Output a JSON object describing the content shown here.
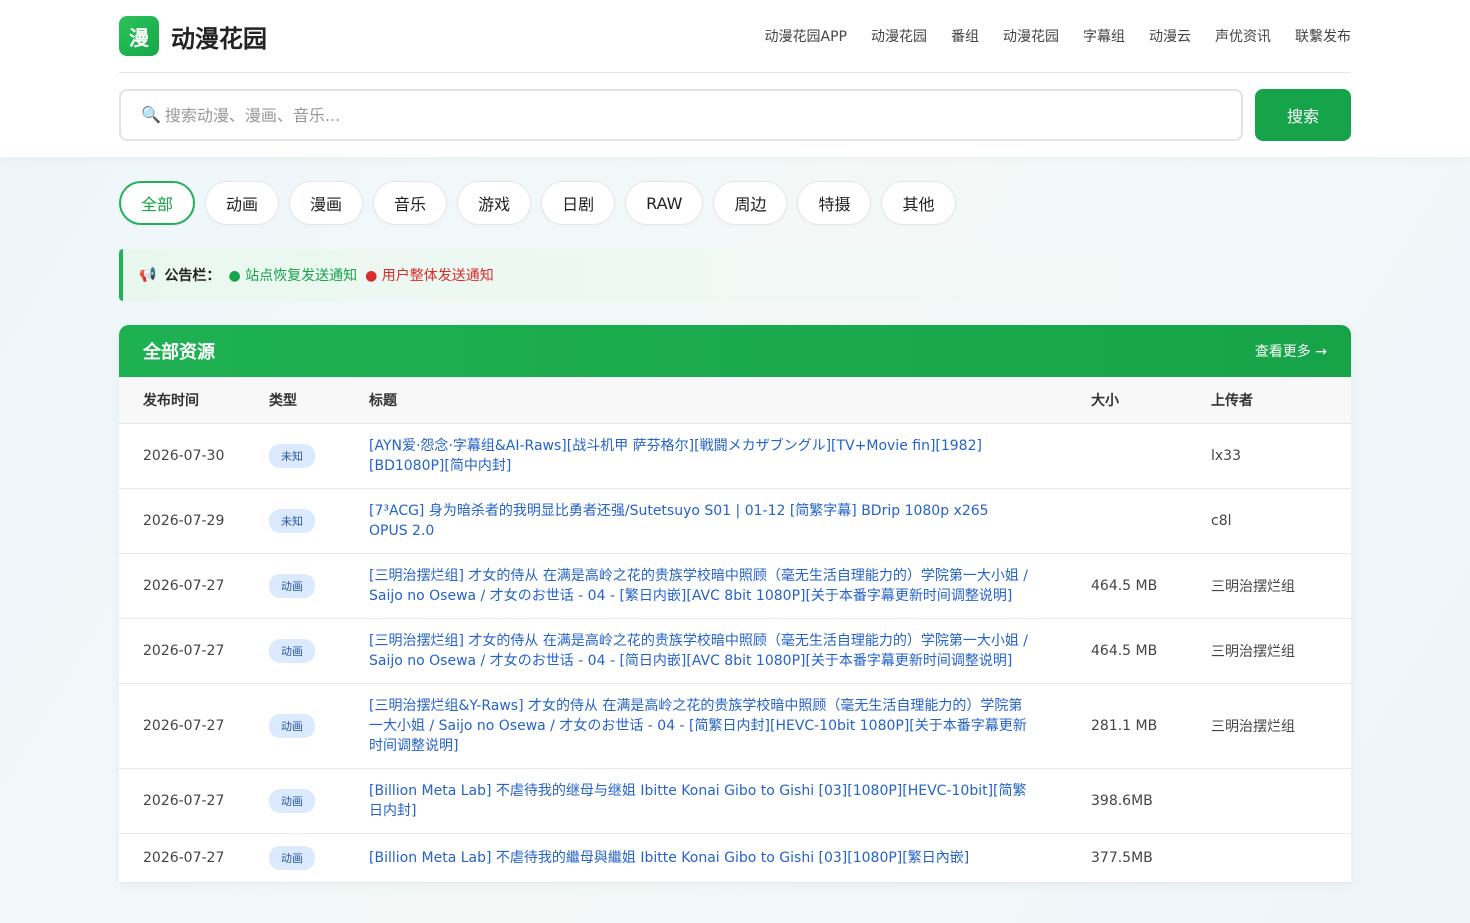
{
  "brand": {
    "logo_char": "漫",
    "name": "动漫花园"
  },
  "nav": [
    "动漫花园APP",
    "动漫花园",
    "番组",
    "动漫花园",
    "字幕组",
    "动漫云",
    "声优资讯",
    "联繫发布"
  ],
  "search": {
    "icon": "🔍",
    "placeholder": "搜索动漫、漫画、音乐...",
    "button": "搜索"
  },
  "categories": [
    "全部",
    "动画",
    "漫画",
    "音乐",
    "游戏",
    "日剧",
    "RAW",
    "周边",
    "特摄",
    "其他"
  ],
  "active_category": "全部",
  "notice": {
    "icon": "📢",
    "label": "公告栏：",
    "items": [
      "● 站点恢复发送通知",
      "● 用户整体发送通知"
    ]
  },
  "panel": {
    "title": "全部资源",
    "more": "查看更多 →"
  },
  "columns": [
    "发布时间",
    "类型",
    "标题",
    "大小",
    "上传者"
  ],
  "rows": [
    {
      "date": "2026-07-30",
      "type": "未知",
      "title": "[AYN爱·怨念·字幕组&AI-Raws][战斗机甲 萨芬格尔][戦闘メカザブングル][TV+Movie fin][1982][BD1080P][简中内封]",
      "size": "",
      "uploader": "lx33"
    },
    {
      "date": "2026-07-29",
      "type": "未知",
      "title": "[7³ACG] 身为暗杀者的我明显比勇者还强/Sutetsuyo S01 | 01-12 [简繁字幕] BDrip 1080p x265 OPUS 2.0",
      "size": "",
      "uploader": "c8l"
    },
    {
      "date": "2026-07-27",
      "type": "动画",
      "title": "[三明治摆烂组] 才女的侍从 在满是高岭之花的贵族学校暗中照顾（毫无生活自理能力的）学院第一大小姐 / Saijo no Osewa / 才女のお世话 - 04 - [繁日内嵌][AVC 8bit 1080P][关于本番字幕更新时间调整说明]",
      "size": "464.5 MB",
      "uploader": "三明治摆烂组"
    },
    {
      "date": "2026-07-27",
      "type": "动画",
      "title": "[三明治摆烂组] 才女的侍从 在满是高岭之花的贵族学校暗中照顾（毫无生活自理能力的）学院第一大小姐 / Saijo no Osewa / 才女のお世话 - 04 - [简日内嵌][AVC 8bit 1080P][关于本番字幕更新时间调整说明]",
      "size": "464.5 MB",
      "uploader": "三明治摆烂组"
    },
    {
      "date": "2026-07-27",
      "type": "动画",
      "title": "[三明治摆烂组&Y-Raws] 才女的侍从 在满是高岭之花的贵族学校暗中照顾（毫无生活自理能力的）学院第一大小姐 / Saijo no Osewa / 才女のお世话 - 04 - [简繁日内封][HEVC-10bit 1080P][关于本番字幕更新时间调整说明]",
      "size": "281.1 MB",
      "uploader": "三明治摆烂组"
    },
    {
      "date": "2026-07-27",
      "type": "动画",
      "title": "[Billion Meta Lab] 不虐待我的继母与继姐 Ibitte Konai Gibo to Gishi [03][1080P][HEVC-10bit][简繁日内封]",
      "size": "398.6MB",
      "uploader": ""
    },
    {
      "date": "2026-07-27",
      "type": "动画",
      "title": "[Billion Meta Lab] 不虐待我的繼母與繼姐 Ibitte Konai Gibo to Gishi [03][1080P][繁日內嵌]",
      "size": "377.5MB",
      "uploader": ""
    }
  ]
}
